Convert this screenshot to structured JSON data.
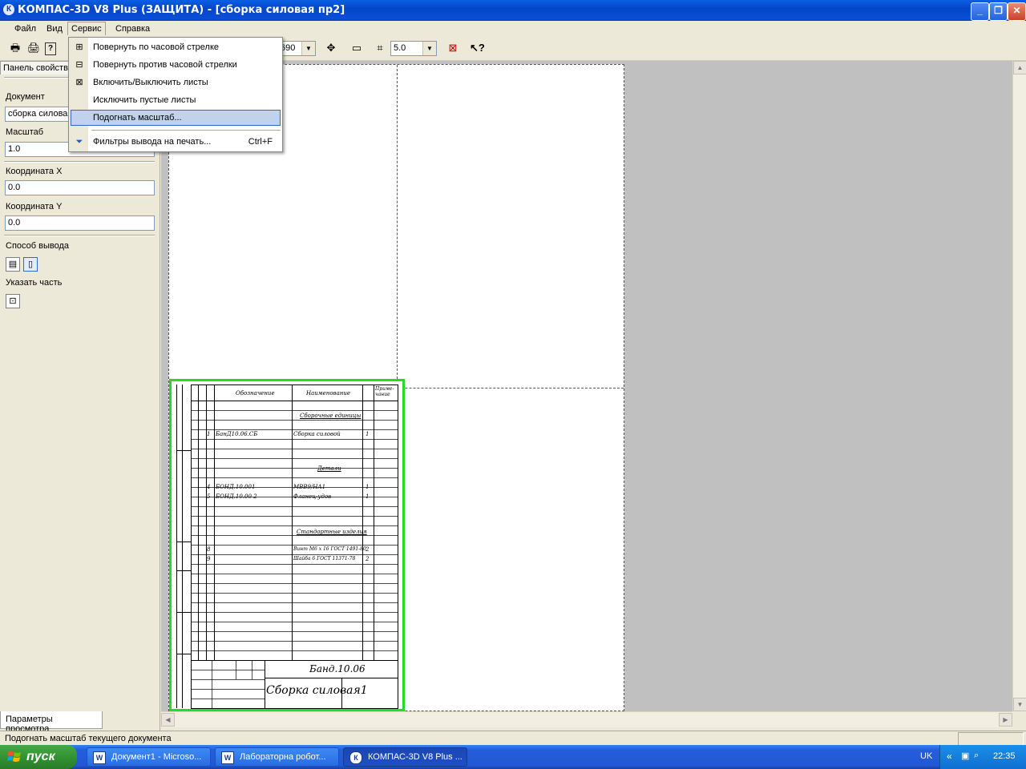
{
  "window": {
    "title": "КОМПАС-3D V8 Plus (ЗАЩИТА) - [сборка силовая пр2]",
    "app_icon": "К",
    "minimize": "_",
    "restore": "❐",
    "close": "✕"
  },
  "menubar": {
    "items": [
      "Файл",
      "Вид",
      "Сервис",
      "Справка"
    ],
    "active": "Сервис"
  },
  "toolbar": {
    "scale_value": "690",
    "step_value": "5.0"
  },
  "service_menu": {
    "items": [
      {
        "label": "Повернуть по часовой стрелке",
        "icon": "rotate-cw-icon",
        "shortcut": ""
      },
      {
        "label": "Повернуть против часовой стрелки",
        "icon": "rotate-ccw-icon",
        "shortcut": ""
      },
      {
        "label": "Включить/Выключить листы",
        "icon": "sheets-toggle-icon",
        "shortcut": ""
      },
      {
        "label": "Исключить пустые листы",
        "icon": "",
        "shortcut": ""
      },
      {
        "label": "Подогнать масштаб...",
        "icon": "",
        "shortcut": "",
        "highlighted": true
      },
      {
        "label": "Фильтры вывода на печать...",
        "icon": "filter-icon",
        "shortcut": "Ctrl+F"
      }
    ]
  },
  "properties_panel": {
    "tab_label": "Панель свойств",
    "document_label": "Документ",
    "document_value": "сборка силова",
    "scale_label": "Масштаб",
    "scale_value": "1.0",
    "coord_x_label": "Координата X",
    "coord_x_value": "0.0",
    "coord_y_label": "Координата Y",
    "coord_y_value": "0.0",
    "output_mode_label": "Способ вывода",
    "select_part_label": "Указать часть",
    "bottom_tab": "Параметры просмотра"
  },
  "drawing": {
    "headers": [
      "Обозначение",
      "Наименование",
      "Приме-чание"
    ],
    "section_assembly": "Сборочные единицы",
    "section_parts": "Детали",
    "section_standard": "Стандартные изделия",
    "rows": [
      {
        "pos": "1",
        "designation": "БанД10.06.СБ",
        "name": "Сборка силовой",
        "qty": "1"
      },
      {
        "pos": "4",
        "designation": "БОНД.10.001",
        "name": "МВВ9/НА1",
        "qty": "1"
      },
      {
        "pos": "5",
        "designation": "БОНД.10.00 2",
        "name": "Фланец-удов",
        "qty": "1"
      },
      {
        "pos": "8",
        "designation": "",
        "name": "Винт М6 х 16 ГОСТ 1491-80",
        "qty": "2"
      },
      {
        "pos": "9",
        "designation": "",
        "name": "Шайба 6 ГОСТ 11371-78",
        "qty": "2"
      }
    ],
    "stamp_code": "Банд.10.06",
    "stamp_name": "Сборка силовая1"
  },
  "statusbar": {
    "text": "Подогнать масштаб текущего документа"
  },
  "taskbar": {
    "start_label": "пуск",
    "tasks": [
      {
        "label": "Документ1 - Microso...",
        "icon": "W",
        "active": false
      },
      {
        "label": "Лабораторна робот...",
        "icon": "W",
        "active": false
      },
      {
        "label": "КОМПАС-3D V8 Plus ...",
        "icon": "К",
        "active": true
      }
    ],
    "language": "UK",
    "clock": "22:35"
  },
  "colors": {
    "titlebar": "#0545c8",
    "highlight": "#c1d2ee",
    "highlight_border": "#316ac5",
    "drawing_frame": "#22dd22",
    "workspace": "#c0c0c0"
  }
}
